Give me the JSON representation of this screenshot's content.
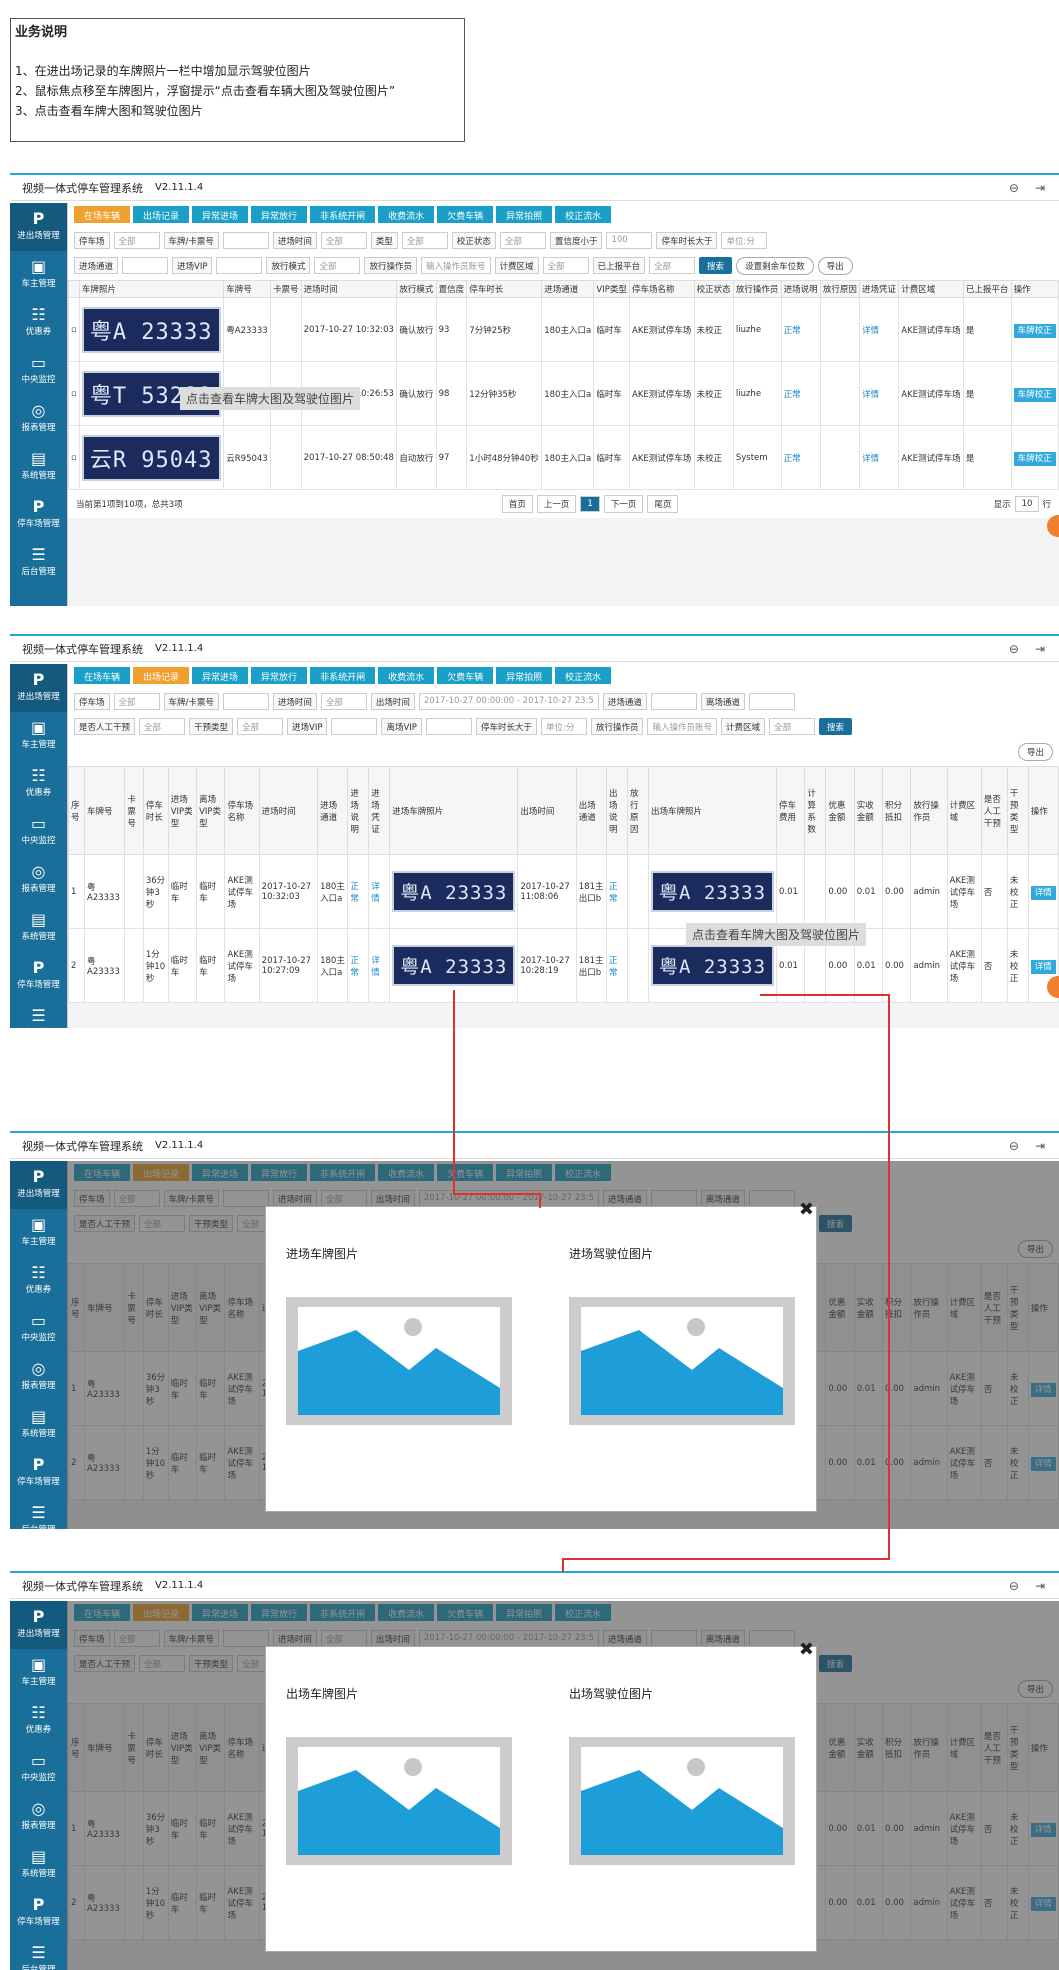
{
  "note": {
    "title": "业务说明",
    "lines": [
      "1、在进出场记录的车牌照片一栏中增加显示驾驶位图片",
      "2、鼠标焦点移至车牌图片，浮窗提示“点击查看车辆大图及驾驶位图片”",
      "3、点击查看车牌大图和驾驶位图片"
    ]
  },
  "app": {
    "title": "视频一体式停车管理系统",
    "version": "V2.11.1.4"
  },
  "sidebar": [
    "进出场管理",
    "车主管理",
    "优惠券",
    "中央监控",
    "报表管理",
    "系统管理",
    "停车场管理",
    "后台管理"
  ],
  "tabs": [
    "在场车辆",
    "出场记录",
    "异常进场",
    "异常放行",
    "非系统开闸",
    "收费流水",
    "欠费车辆",
    "异常拍照",
    "校正流水"
  ],
  "tooltip": "点击查看车牌大图及驾驶位图片",
  "p1": {
    "filters1": [
      "停车场",
      "全部",
      "车牌/卡票号",
      "",
      "进场时间",
      "全部",
      "类型",
      "全部",
      "校正状态",
      "全部",
      "置信度小于",
      "100",
      "停车时长大于",
      "单位:分"
    ],
    "filters2": [
      "进场通道",
      "",
      "进场VIP",
      "",
      "放行模式",
      "全部",
      "放行操作员",
      "输入操作员账号",
      "计费区域",
      "全部",
      "已上报平台",
      "全部",
      "搜索",
      "设置剩余车位数",
      "导出"
    ],
    "headers": [
      "车牌照片",
      "车牌号",
      "卡票号",
      "进场时间",
      "放行模式",
      "置信度",
      "停车时长",
      "进场通道",
      "VIP类型",
      "停车场名称",
      "校正状态",
      "放行操作员",
      "进场说明",
      "放行原因",
      "进场凭证",
      "计费区域",
      "已上报平台",
      "操作"
    ],
    "rows": [
      {
        "plate_img": "粤A 23333",
        "plate": "粤A23333",
        "card": "",
        "time": "2017-10-27 10:32:03",
        "mode": "确认放行",
        "conf": "93",
        "dur": "7分钟25秒",
        "lane": "180主入口a",
        "vip": "临时车",
        "lot": "AKE测试停车场",
        "fix": "未校正",
        "op": "liuzhe",
        "desc": "正常",
        "reason": "",
        "proof": "详情",
        "area": "AKE测试停车场",
        "rep": "是",
        "act": "车牌校正"
      },
      {
        "plate_img": "粤T 53289",
        "plate": "粤T53289",
        "card": "",
        "time": "2017-10-27 10:26:53",
        "mode": "确认放行",
        "conf": "98",
        "dur": "12分钟35秒",
        "lane": "180主入口a",
        "vip": "临时车",
        "lot": "AKE测试停车场",
        "fix": "未校正",
        "op": "liuzhe",
        "desc": "正常",
        "reason": "",
        "proof": "详情",
        "area": "AKE测试停车场",
        "rep": "是",
        "act": "车牌校正"
      },
      {
        "plate_img": "云R 95043",
        "plate": "云R95043",
        "card": "",
        "time": "2017-10-27 08:50:48",
        "mode": "自动放行",
        "conf": "97",
        "dur": "1小时48分钟40秒",
        "lane": "180主入口a",
        "vip": "临时车",
        "lot": "AKE测试停车场",
        "fix": "未校正",
        "op": "System",
        "desc": "正常",
        "reason": "",
        "proof": "详情",
        "area": "AKE测试停车场",
        "rep": "是",
        "act": "车牌校正"
      }
    ],
    "pager": {
      "info": "当前第1项到10项，总共3项",
      "first": "首页",
      "prev": "上一页",
      "cur": "1",
      "next": "下一页",
      "last": "尾页",
      "show": "显示",
      "size": "10",
      "unit": "行"
    }
  },
  "p2": {
    "filters1": [
      "停车场",
      "全部",
      "车牌/卡票号",
      "",
      "进场时间",
      "全部",
      "出场时间",
      "2017-10-27 00:00:00 - 2017-10-27 23:5",
      "进场通道",
      "",
      "离场通道",
      ""
    ],
    "filters2": [
      "是否人工干预",
      "全部",
      "干预类型",
      "全部",
      "进场VIP",
      "",
      "离场VIP",
      "",
      "停车时长大于",
      "单位:分",
      "放行操作员",
      "输入操作员账号",
      "计费区域",
      "全部",
      "搜索"
    ],
    "export": "导出",
    "headers": [
      "序号",
      "车牌号",
      "卡票号",
      "停车时长",
      "进场VIP类型",
      "离场VIP类型",
      "停车场名称",
      "进场时间",
      "进场通道",
      "进场说明",
      "进场凭证",
      "进场车牌照片",
      "出场时间",
      "出场通道",
      "出场说明",
      "放行原因",
      "出场车牌照片",
      "停车费用",
      "计算系数",
      "优惠金额",
      "实收金额",
      "积分抵扣",
      "放行操作员",
      "计费区域",
      "是否人工干预",
      "干预类型",
      "操作"
    ],
    "rows": [
      {
        "no": "1",
        "plate": "粤A23333",
        "card": "",
        "dur": "36分钟3秒",
        "invip": "临时车",
        "outvip": "临时车",
        "lot": "AKE测试停车场",
        "intime": "2017-10-27 10:32:03",
        "inlane": "180主入口a",
        "indesc": "正常",
        "proof": "详情",
        "inimg": "粤A 23333",
        "outtime": "2017-10-27 11:08:06",
        "outlane": "181主出口b",
        "outdesc": "正常",
        "reason": "",
        "outimg": "粤A 23333",
        "fee": "0.01",
        "coef": "",
        "disc": "0.00",
        "paid": "0.01",
        "pts": "0.00",
        "op": "admin",
        "area": "AKE测试停车场",
        "manual": "否",
        "itype": "未校正",
        "act": "详情"
      },
      {
        "no": "2",
        "plate": "粤A23333",
        "card": "",
        "dur": "1分钟10秒",
        "invip": "临时车",
        "outvip": "临时车",
        "lot": "AKE测试停车场",
        "intime": "2017-10-27 10:27:09",
        "inlane": "180主入口a",
        "indesc": "正常",
        "proof": "详情",
        "inimg": "粤A 23333",
        "outtime": "2017-10-27 10:28:19",
        "outlane": "181主出口b",
        "outdesc": "正常",
        "reason": "",
        "outimg": "粤A 23333",
        "fee": "0.01",
        "coef": "",
        "disc": "0.00",
        "paid": "0.01",
        "pts": "0.00",
        "op": "admin",
        "area": "AKE测试停车场",
        "manual": "否",
        "itype": "未校正",
        "act": "详情"
      }
    ]
  },
  "modal1": {
    "left": "进场车牌图片",
    "right": "进场驾驶位图片"
  },
  "modal2": {
    "left": "出场车牌图片",
    "right": "出场驾驶位图片"
  },
  "colors": {
    "accent": "#22a7d6",
    "sidebar": "#1a6f9a",
    "activeTab": "#f0a030",
    "tab": "#1aa0c8",
    "line": "#e03030",
    "imgBlue": "#1e9ed8"
  }
}
